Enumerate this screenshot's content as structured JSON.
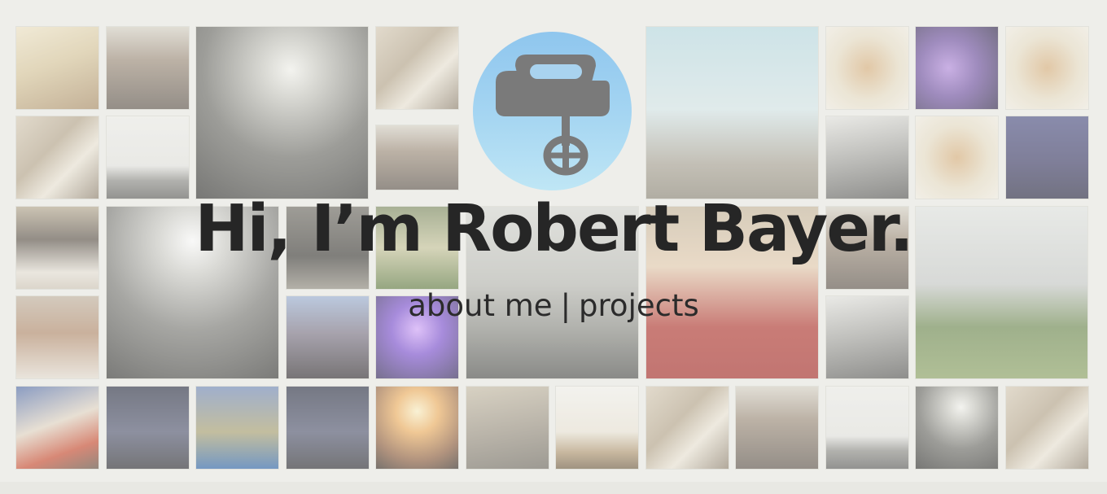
{
  "hero": {
    "title": "Hi, I’m Robert Bayer.",
    "nav": {
      "about_label": "about me",
      "separator": "|",
      "projects_label": "projects"
    }
  },
  "logo": {
    "icon": "hand-mixer-icon",
    "circle_color_top": "#8fc6ee",
    "circle_color_bottom": "#bfe6f5",
    "mixer_color": "#7a7a7a"
  },
  "colors": {
    "background": "#eeeeea",
    "text": "#262626"
  },
  "mosaic": {
    "photo_count": 38
  }
}
